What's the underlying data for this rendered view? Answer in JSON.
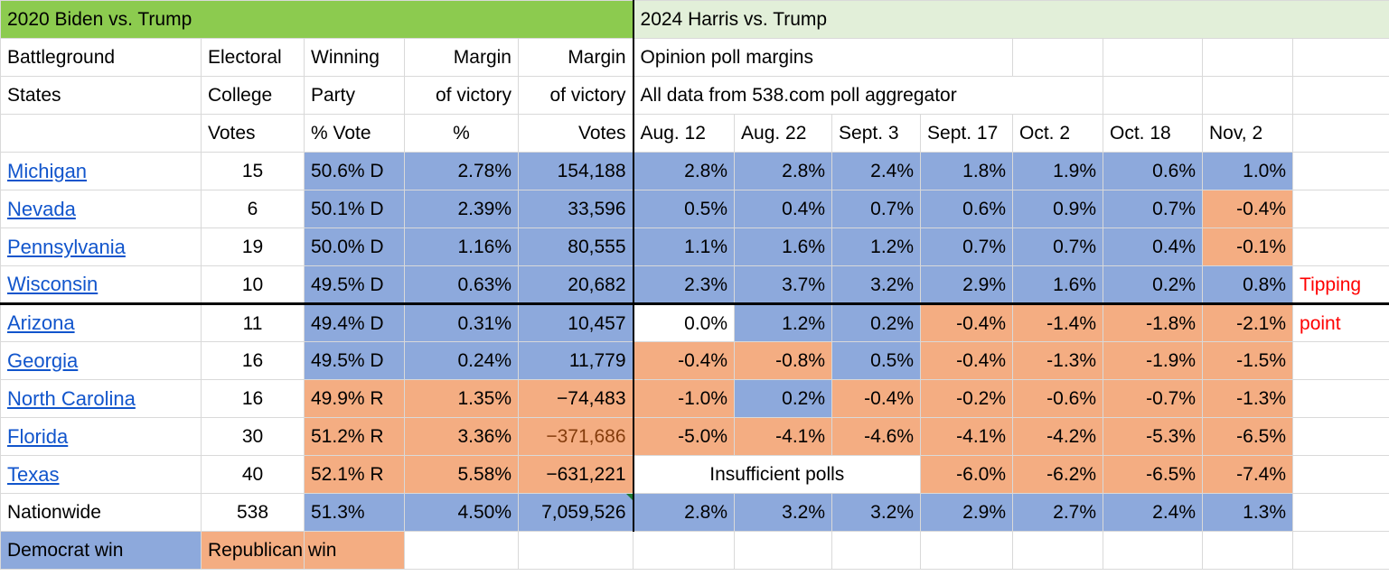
{
  "sheet": {
    "section_titles": {
      "left": "2020 Biden vs. Trump",
      "right": "2024 Harris vs. Trump"
    },
    "subheaders": {
      "right_line1": "Opinion poll margins",
      "right_line2": "All data from 538.com poll aggregator"
    },
    "annotation": {
      "line1": "Tipping",
      "line2": "point",
      "color": "#FF0000"
    },
    "insufficient_polls": "Insufficient polls",
    "legend": {
      "democrat": "Democrat win",
      "republican": "Republican win"
    },
    "colors": {
      "democrat_fill": "#8DA9DC",
      "republican_fill": "#F4AD82",
      "header_green": "#8CCB4F",
      "header_light_green": "#E2EFD9",
      "link_blue": "#1155CC",
      "annotation_red": "#FF0000"
    },
    "columns": {
      "state": [
        "Battleground",
        "States",
        ""
      ],
      "ec": [
        "Electoral",
        "College",
        "Votes"
      ],
      "party": [
        "Winning",
        "Party",
        "% Vote"
      ],
      "margin_pct": [
        "Margin",
        "of victory",
        "%"
      ],
      "margin_votes": [
        "Margin",
        "of victory",
        "Votes"
      ],
      "poll_dates": [
        "Aug. 12",
        "Aug. 22",
        "Sept. 3",
        "Sept. 17",
        "Oct. 2",
        "Oct. 18",
        "Nov, 2"
      ]
    },
    "rows": [
      {
        "state": "Michigan",
        "ec": "15",
        "party": "50.6% D",
        "margin_pct": "2.78%",
        "margin_votes": "154,188",
        "party_fill": "blue",
        "pct_fill": "blue",
        "votes_fill": "blue",
        "polls": [
          "2.8%",
          "2.8%",
          "2.4%",
          "1.8%",
          "1.9%",
          "0.6%",
          "1.0%"
        ],
        "poll_fills": [
          "blue",
          "blue",
          "blue",
          "blue",
          "blue",
          "blue",
          "blue"
        ]
      },
      {
        "state": "Nevada",
        "ec": "6",
        "party": "50.1% D",
        "margin_pct": "2.39%",
        "margin_votes": "33,596",
        "party_fill": "blue",
        "pct_fill": "blue",
        "votes_fill": "blue",
        "polls": [
          "0.5%",
          "0.4%",
          "0.7%",
          "0.6%",
          "0.9%",
          "0.7%",
          "-0.4%"
        ],
        "poll_fills": [
          "blue",
          "blue",
          "blue",
          "blue",
          "blue",
          "blue",
          "orange"
        ]
      },
      {
        "state": "Pennsylvania",
        "ec": "19",
        "party": "50.0% D",
        "margin_pct": "1.16%",
        "margin_votes": "80,555",
        "party_fill": "blue",
        "pct_fill": "blue",
        "votes_fill": "blue",
        "polls": [
          "1.1%",
          "1.6%",
          "1.2%",
          "0.7%",
          "0.7%",
          "0.4%",
          "-0.1%"
        ],
        "poll_fills": [
          "blue",
          "blue",
          "blue",
          "blue",
          "blue",
          "blue",
          "orange"
        ]
      },
      {
        "state": "Wisconsin",
        "ec": "10",
        "party": "49.5% D",
        "margin_pct": "0.63%",
        "margin_votes": "20,682",
        "party_fill": "blue",
        "pct_fill": "blue",
        "votes_fill": "blue",
        "polls": [
          "2.3%",
          "3.7%",
          "3.2%",
          "2.9%",
          "1.6%",
          "0.2%",
          "0.8%"
        ],
        "poll_fills": [
          "blue",
          "blue",
          "blue",
          "blue",
          "blue",
          "blue",
          "blue"
        ]
      },
      {
        "state": "Arizona",
        "ec": "11",
        "party": "49.4% D",
        "margin_pct": "0.31%",
        "margin_votes": "10,457",
        "party_fill": "blue",
        "pct_fill": "blue",
        "votes_fill": "blue",
        "polls": [
          "0.0%",
          "1.2%",
          "0.2%",
          "-0.4%",
          "-1.4%",
          "-1.8%",
          "-2.1%"
        ],
        "poll_fills": [
          "white",
          "blue",
          "blue",
          "orange",
          "orange",
          "orange",
          "orange"
        ]
      },
      {
        "state": "Georgia",
        "ec": "16",
        "party": "49.5% D",
        "margin_pct": "0.24%",
        "margin_votes": "11,779",
        "party_fill": "blue",
        "pct_fill": "blue",
        "votes_fill": "blue",
        "polls": [
          "-0.4%",
          "-0.8%",
          "0.5%",
          "-0.4%",
          "-1.3%",
          "-1.9%",
          "-1.5%"
        ],
        "poll_fills": [
          "orange",
          "orange",
          "blue",
          "orange",
          "orange",
          "orange",
          "orange"
        ]
      },
      {
        "state": "North Carolina",
        "ec": "16",
        "party": "49.9% R",
        "margin_pct": "1.35%",
        "margin_votes": "−74,483",
        "party_fill": "orange",
        "pct_fill": "orange",
        "votes_fill": "orange",
        "polls": [
          "-1.0%",
          "0.2%",
          "-0.4%",
          "-0.2%",
          "-0.6%",
          "-0.7%",
          "-1.3%"
        ],
        "poll_fills": [
          "orange",
          "blue",
          "orange",
          "orange",
          "orange",
          "orange",
          "orange"
        ]
      },
      {
        "state": "Florida",
        "ec": "30",
        "party": "51.2% R",
        "margin_pct": "3.36%",
        "margin_votes": "−371,686",
        "party_fill": "orange",
        "pct_fill": "orange",
        "votes_fill": "orange",
        "votes_text_brown": true,
        "polls": [
          "-5.0%",
          "-4.1%",
          "-4.6%",
          "-4.1%",
          "-4.2%",
          "-5.3%",
          "-6.5%"
        ],
        "poll_fills": [
          "orange",
          "orange",
          "orange",
          "orange",
          "orange",
          "orange",
          "orange"
        ]
      },
      {
        "state": "Texas",
        "ec": "40",
        "party": "52.1% R",
        "margin_pct": "5.58%",
        "margin_votes": "−631,221",
        "party_fill": "orange",
        "pct_fill": "orange",
        "votes_fill": "orange",
        "polls": [
          "",
          "",
          "",
          "-6.0%",
          "-6.2%",
          "-6.5%",
          "-7.4%"
        ],
        "poll_fills": [
          "white",
          "white",
          "white",
          "orange",
          "orange",
          "orange",
          "orange"
        ]
      }
    ],
    "nationwide": {
      "state": "Nationwide",
      "ec": "538",
      "party": "51.3%",
      "margin_pct": "4.50%",
      "margin_votes": "7,059,526",
      "polls": [
        "2.8%",
        "3.2%",
        "3.2%",
        "2.9%",
        "2.7%",
        "2.4%",
        "1.3%"
      ]
    }
  }
}
